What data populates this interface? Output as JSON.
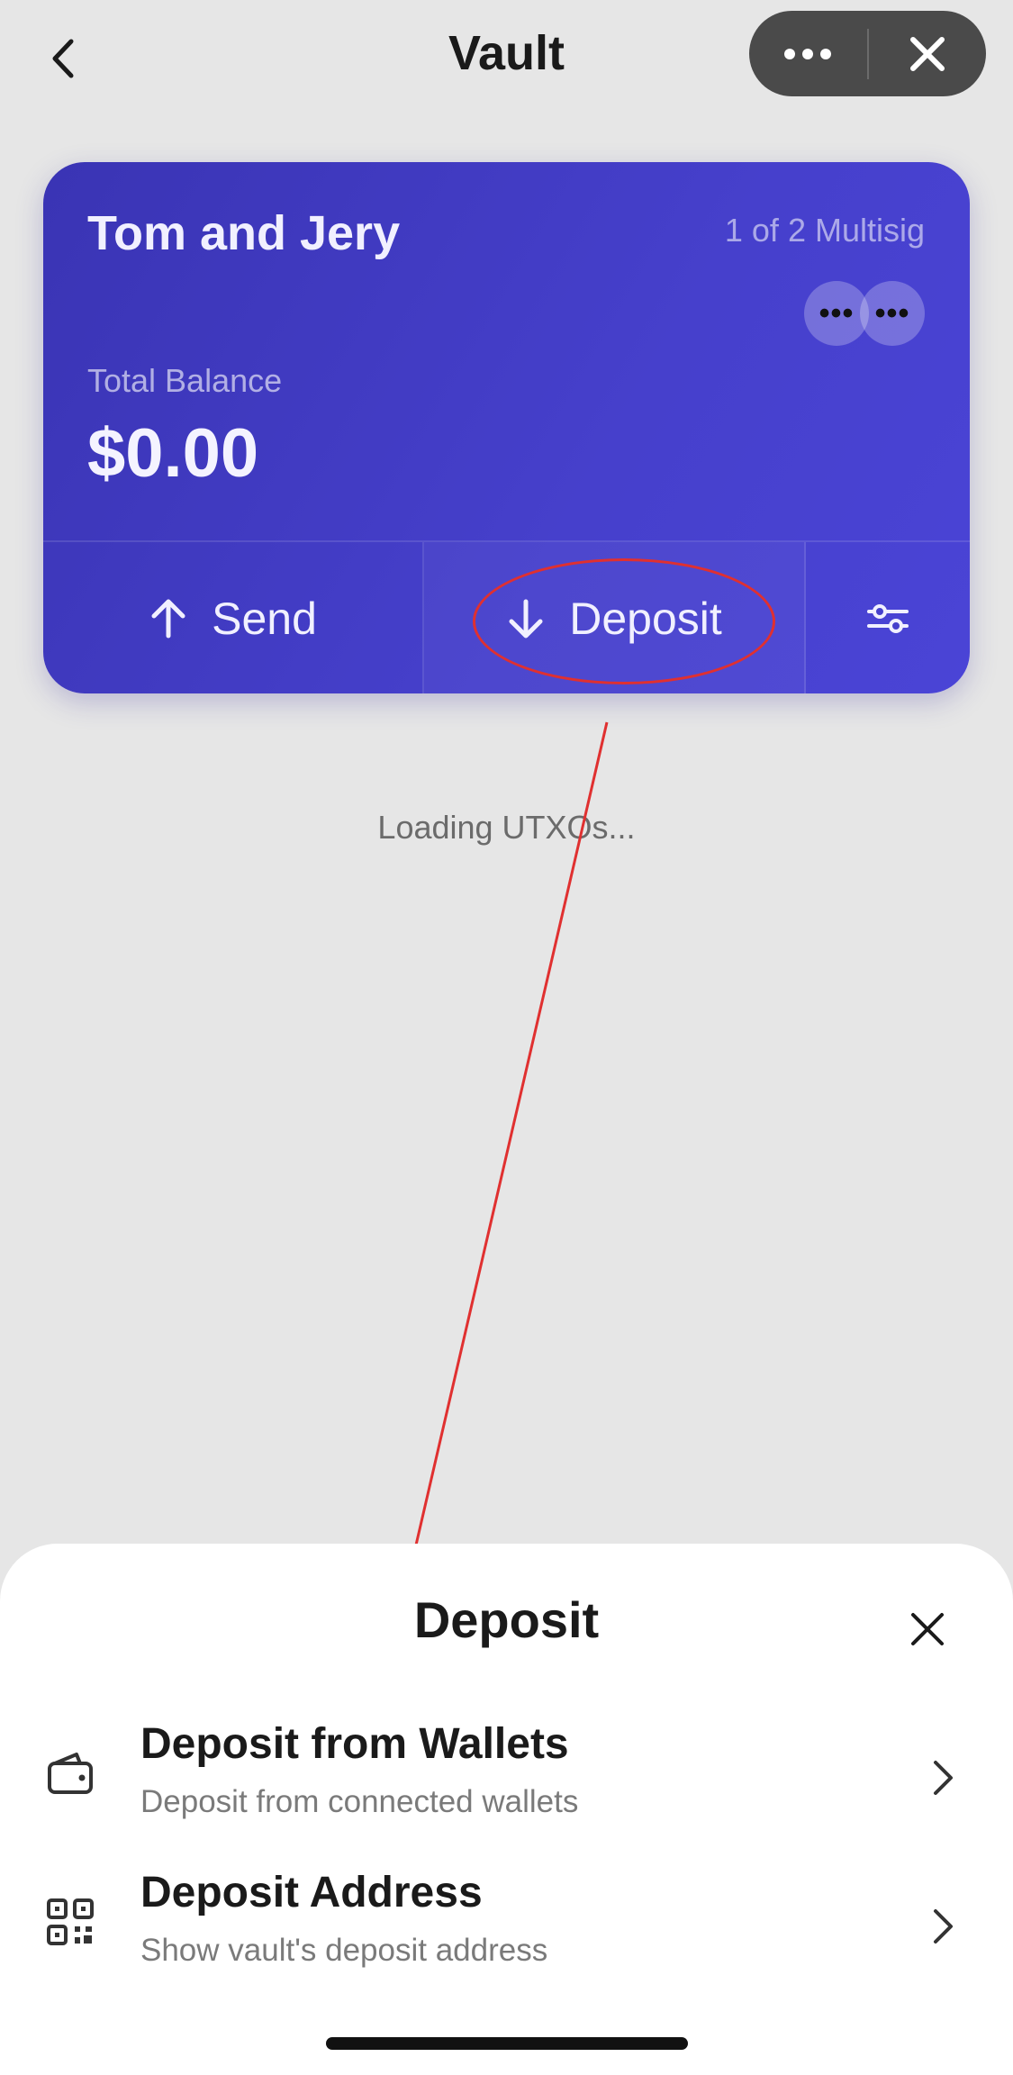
{
  "header": {
    "title": "Vault",
    "back_icon": "chevron-left-icon",
    "more_icon": "more-horizontal-icon",
    "close_icon": "close-icon"
  },
  "vault_card": {
    "name": "Tom and Jery",
    "type": "1 of 2 Multisig",
    "signers": [
      "•••",
      "•••"
    ],
    "balance_label": "Total Balance",
    "balance_value": "$0.00",
    "actions": {
      "send_label": "Send",
      "deposit_label": "Deposit",
      "settings_icon": "sliders-icon"
    },
    "colors": {
      "gradient_start": "#3a34b4",
      "gradient_end": "#4a44d6"
    }
  },
  "status": {
    "loading_text": "Loading UTXOs..."
  },
  "annotation": {
    "color": "#e03030"
  },
  "deposit_sheet": {
    "title": "Deposit",
    "options": [
      {
        "title": "Deposit from Wallets",
        "subtitle": "Deposit from connected wallets",
        "icon": "wallet-icon"
      },
      {
        "title": "Deposit Address",
        "subtitle": "Show vault's deposit address",
        "icon": "qr-code-icon"
      }
    ]
  }
}
